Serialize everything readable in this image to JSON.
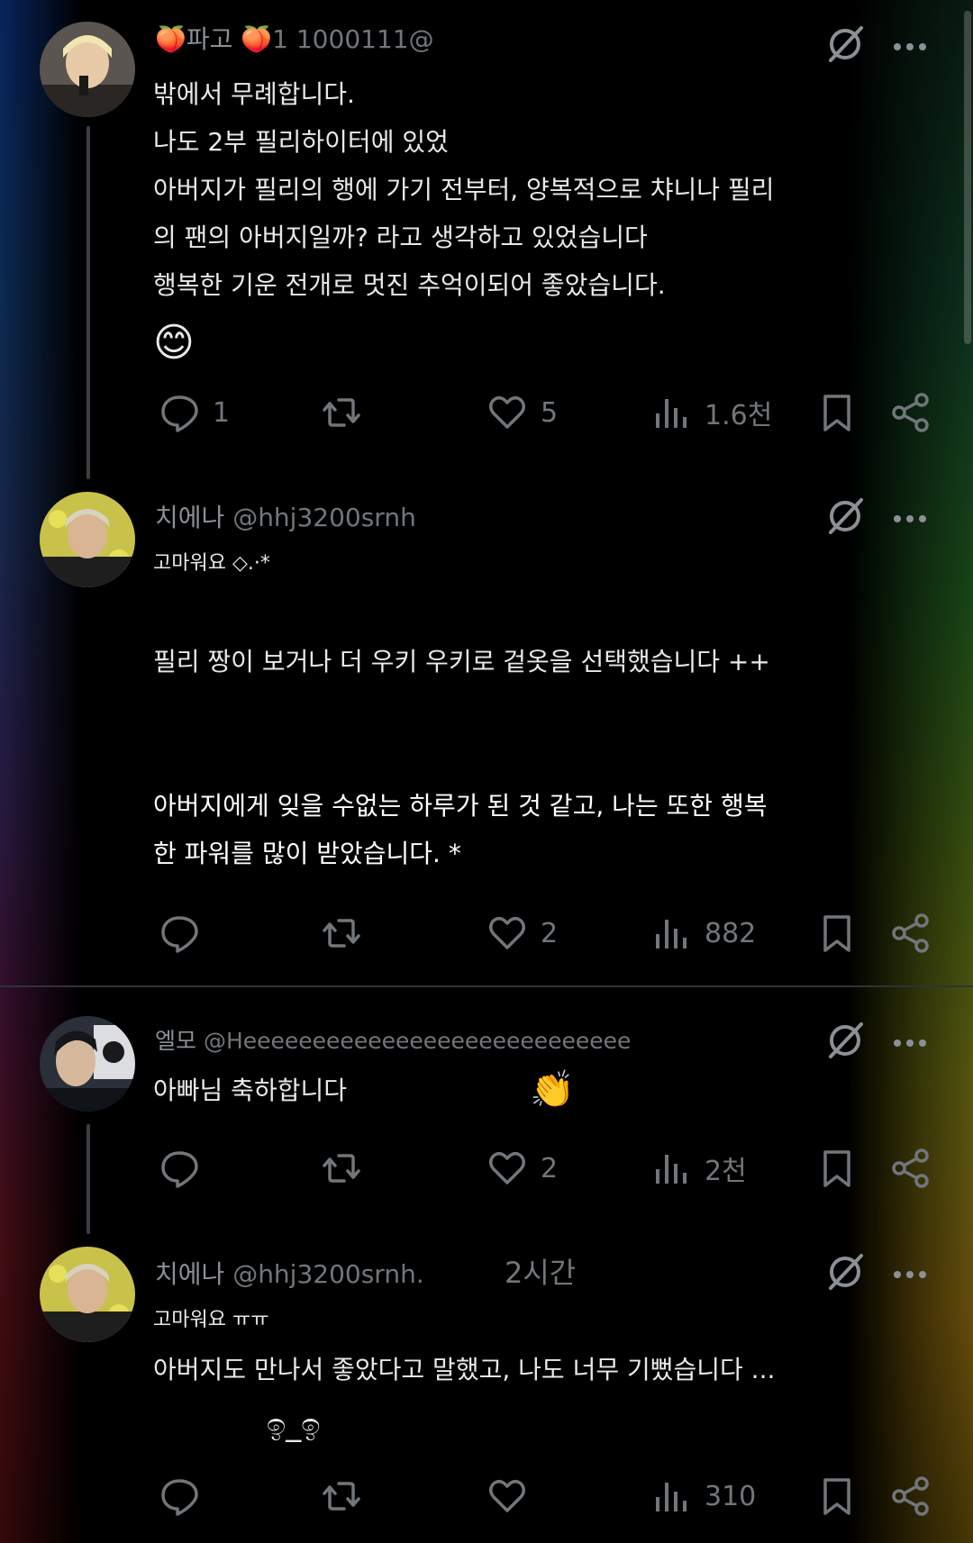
{
  "posts": [
    {
      "name": "🍑파고 🍑",
      "handle": "1 1000111@",
      "lines": [
        "밖에서 무례합니다.",
        "나도 2부 필리하이터에 있었",
        "아버지가 필리의 행에 가기 전부터, 양복적으로 챠니나 필리",
        " 의 팬의 아버지일까? 라고 생각하고 있었습니다",
        "행복한 기운 전개로 멋진 추억이되어 좋았습니다."
      ],
      "emoji": "😊",
      "stats": {
        "reply": "1",
        "repost": "",
        "like": "5",
        "views": "1.6천"
      }
    },
    {
      "name": "치에나",
      "handle": "@hhj3200srnh",
      "small": "고마워요 ◇.·*",
      "lines": [
        "필리 짱이 보거나 더 우키 우키로 겉옷을 선택했습니다 ++",
        "아버지에게 잊을 수없는 하루가 된 것 같고, 나는 또한 행복",
        " 한 파워를 많이 받았습니다. *"
      ],
      "stats": {
        "reply": "",
        "repost": "",
        "like": "2",
        "views": "882"
      }
    },
    {
      "name": "엘모",
      "handle": "@Heeeeeeeeeeeeeeeeeeeeeeeeeeee",
      "lines": [
        "아빠님 축하합니다"
      ],
      "emoji": "👏",
      "stats": {
        "reply": "",
        "repost": "",
        "like": "2",
        "views": "2천"
      }
    },
    {
      "name": "치에나",
      "handle": "@hhj3200srnh.",
      "time": "2시간",
      "small": "고마워요 ㅠㅠ",
      "lines": [
        "아버지도 만나서 좋았다고 말했고, 나도 너무 기뻤습니다 ...",
        "ඉ_ඉ"
      ],
      "stats": {
        "reply": "",
        "repost": "",
        "like": "",
        "views": "310"
      }
    }
  ],
  "colors": {
    "text": "#e7e9ea",
    "muted": "#71767b",
    "divider": "#2f3336",
    "background": "#000000"
  }
}
